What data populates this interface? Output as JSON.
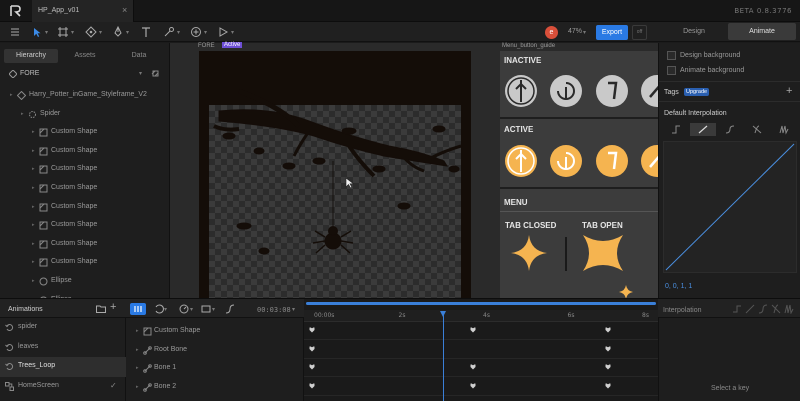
{
  "window": {
    "document_tab": "HP_App_v01",
    "close_glyph": "×",
    "version": "BETA 0.8.3776"
  },
  "toolbar": {
    "zoom": "47%",
    "export_label": "Export",
    "avatar_letter": "e",
    "avatar_color": "#d94f3a",
    "accent_color": "#2a7ae4"
  },
  "mode_switch": {
    "design": "Design",
    "animate": "Animate",
    "active": "Animate"
  },
  "left_panel": {
    "tabs": [
      "Hierarchy",
      "Assets",
      "Data"
    ],
    "active_tab": "Hierarchy",
    "root": "FORE",
    "items": [
      {
        "label": "Harry_Potter_inGame_Styleframe_V2",
        "icon": "artboard-icon",
        "depth": 0
      },
      {
        "label": "Spider",
        "icon": "group-icon",
        "depth": 1
      },
      {
        "label": "Custom Shape",
        "icon": "shape-icon",
        "depth": 2
      },
      {
        "label": "Custom Shape",
        "icon": "shape-icon",
        "depth": 2
      },
      {
        "label": "Custom Shape",
        "icon": "shape-icon",
        "depth": 2
      },
      {
        "label": "Custom Shape",
        "icon": "shape-icon",
        "depth": 2
      },
      {
        "label": "Custom Shape",
        "icon": "shape-icon",
        "depth": 2
      },
      {
        "label": "Custom Shape",
        "icon": "shape-icon",
        "depth": 2
      },
      {
        "label": "Custom Shape",
        "icon": "shape-icon",
        "depth": 2
      },
      {
        "label": "Custom Shape",
        "icon": "shape-icon",
        "depth": 2
      },
      {
        "label": "Ellipse",
        "icon": "ellipse-icon",
        "depth": 2
      },
      {
        "label": "Ellipse",
        "icon": "ellipse-icon",
        "depth": 2
      }
    ]
  },
  "canvas": {
    "artboard_label": "FORE",
    "active_badge": "Active",
    "guide_label": "Menu_button_guide",
    "guide": {
      "inactive_title": "INACTIVE",
      "active_title": "ACTIVE",
      "menu_title": "MENU",
      "tab_closed": "TAB CLOSED",
      "tab_open": "TAB OPEN",
      "inactive_color": "#c9c9c9",
      "active_color": "#f5b450"
    }
  },
  "right_panel": {
    "design_background": "Design background",
    "animate_background": "Animate background",
    "tags_label": "Tags",
    "upgrade_badge": "Upgrade",
    "default_interpolation": "Default Interpolation",
    "curve_values": "0, 0, 1, 1"
  },
  "timeline": {
    "animations_title": "Animations",
    "time": "00:03:08",
    "interpolation_title": "Interpolation",
    "select_key": "Select a key",
    "ruler_labels": [
      "00:00s",
      "2s",
      "4s",
      "6s",
      "8s"
    ],
    "playhead_seconds": 3.1,
    "animations": [
      {
        "name": "spider",
        "icon": "loop-icon"
      },
      {
        "name": "leaves",
        "icon": "loop-icon"
      },
      {
        "name": "Trees_Loop",
        "icon": "loop-icon",
        "selected": true
      },
      {
        "name": "HomeScreen",
        "icon": "state-machine-icon"
      }
    ],
    "tracks": [
      {
        "name": "Custom Shape",
        "icon": "shape-icon",
        "keys_seconds": [
          0,
          3.8,
          7.0
        ]
      },
      {
        "name": "Root Bone",
        "icon": "bone-icon",
        "keys_seconds": [
          0,
          7.0
        ]
      },
      {
        "name": "Bone 1",
        "icon": "bone-icon",
        "keys_seconds": [
          0,
          3.8,
          7.0
        ]
      },
      {
        "name": "Bone 2",
        "icon": "bone-icon",
        "keys_seconds": [
          0,
          3.8,
          7.0
        ]
      }
    ]
  }
}
